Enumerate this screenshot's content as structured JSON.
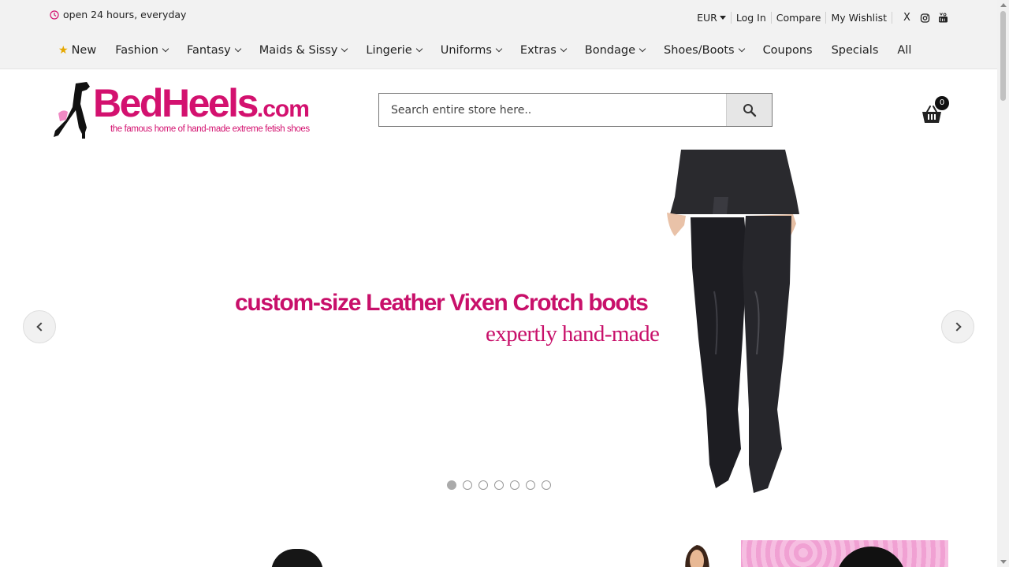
{
  "topbar": {
    "hours_text": "open 24 hours, everyday",
    "currency": "EUR",
    "links": [
      "Log In",
      "Compare",
      "My Wishlist"
    ],
    "social": [
      "X",
      "instagram-icon",
      "youtube-icon"
    ]
  },
  "nav": {
    "items": [
      {
        "label": "New",
        "icon": "star-icon",
        "dropdown": false
      },
      {
        "label": "Fashion",
        "dropdown": true
      },
      {
        "label": "Fantasy",
        "dropdown": true
      },
      {
        "label": "Maids & Sissy",
        "dropdown": true
      },
      {
        "label": "Lingerie",
        "dropdown": true
      },
      {
        "label": "Uniforms",
        "dropdown": true
      },
      {
        "label": "Extras",
        "dropdown": true
      },
      {
        "label": "Bondage",
        "dropdown": true
      },
      {
        "label": "Shoes/Boots",
        "dropdown": true
      },
      {
        "label": "Coupons",
        "dropdown": false
      },
      {
        "label": "Specials",
        "dropdown": false
      },
      {
        "label": "All",
        "dropdown": false
      }
    ]
  },
  "logo": {
    "brand": "BedHeels",
    "domain_suffix": ".com",
    "tagline": "the famous home of hand-made extreme fetish shoes"
  },
  "search": {
    "placeholder": "Search entire store here.."
  },
  "cart": {
    "count": "0"
  },
  "slider": {
    "headline": "custom-size Leather Vixen Crotch boots",
    "subline": "expertly hand-made",
    "slide_count": 7,
    "active_slide": 1
  },
  "colors": {
    "brand_pink": "#d3116f",
    "accent_star": "#e6a800",
    "topbar_bg": "#f2f2f2"
  }
}
